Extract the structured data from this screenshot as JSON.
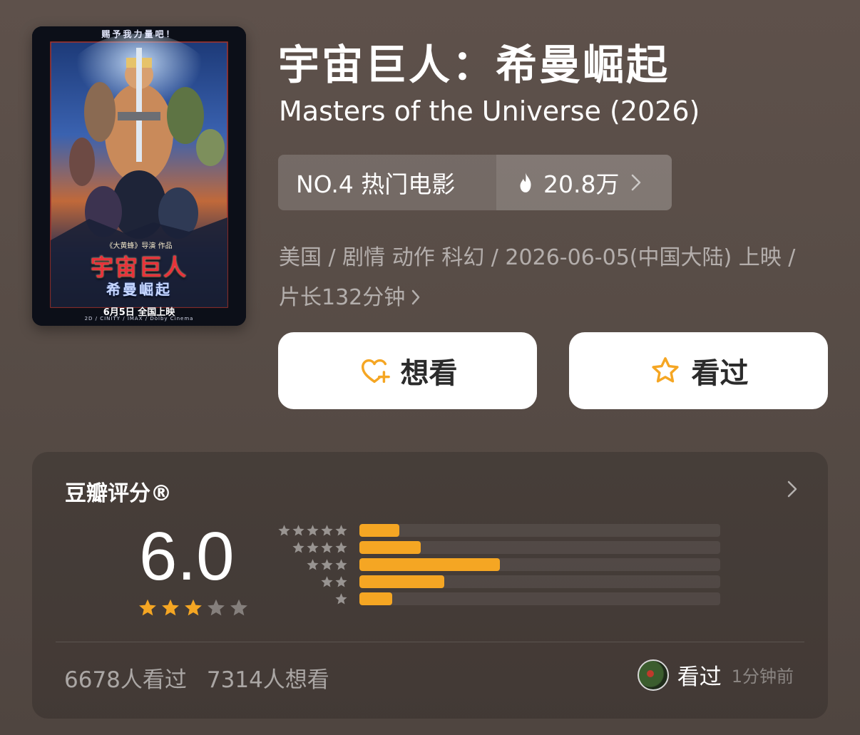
{
  "poster": {
    "tagline": "赐予我力量吧！",
    "director_line": "《大黄蜂》导演 作品",
    "title_cn": "宇宙巨人",
    "title_cn_sub": "希曼崛起",
    "release": "6月5日 全国上映",
    "formats": "2D / CINITY / IMAX / Dolby Cinema"
  },
  "movie": {
    "title_cn": "宇宙巨人：希曼崛起",
    "title_en": "Masters of the Universe (2026)"
  },
  "ranking": {
    "rank_label": "NO.4 热门电影",
    "heat_value": "20.8万",
    "heat_icon": "flame-icon"
  },
  "meta": {
    "info": "美国 / 剧情 动作 科幻 / 2026-06-05(中国大陆) 上映 / 片长132分钟"
  },
  "actions": {
    "want_label": "想看",
    "want_icon": "heart-plus-icon",
    "seen_label": "看过",
    "seen_icon": "star-outline-icon"
  },
  "rating": {
    "title": "豆瓣评分®",
    "score": "6.0",
    "stars_filled": 3,
    "stars_total": 5,
    "distribution": [
      {
        "stars": 5,
        "fraction": 0.11
      },
      {
        "stars": 4,
        "fraction": 0.17
      },
      {
        "stars": 3,
        "fraction": 0.39
      },
      {
        "stars": 2,
        "fraction": 0.235
      },
      {
        "stars": 1,
        "fraction": 0.09
      }
    ],
    "watched_count": "6678人看过",
    "want_count": "7314人想看",
    "activity_label": "看过",
    "activity_time": "1分钟前"
  },
  "colors": {
    "accent": "#f5a623",
    "background": "#594d47",
    "card": "#ffffff"
  }
}
